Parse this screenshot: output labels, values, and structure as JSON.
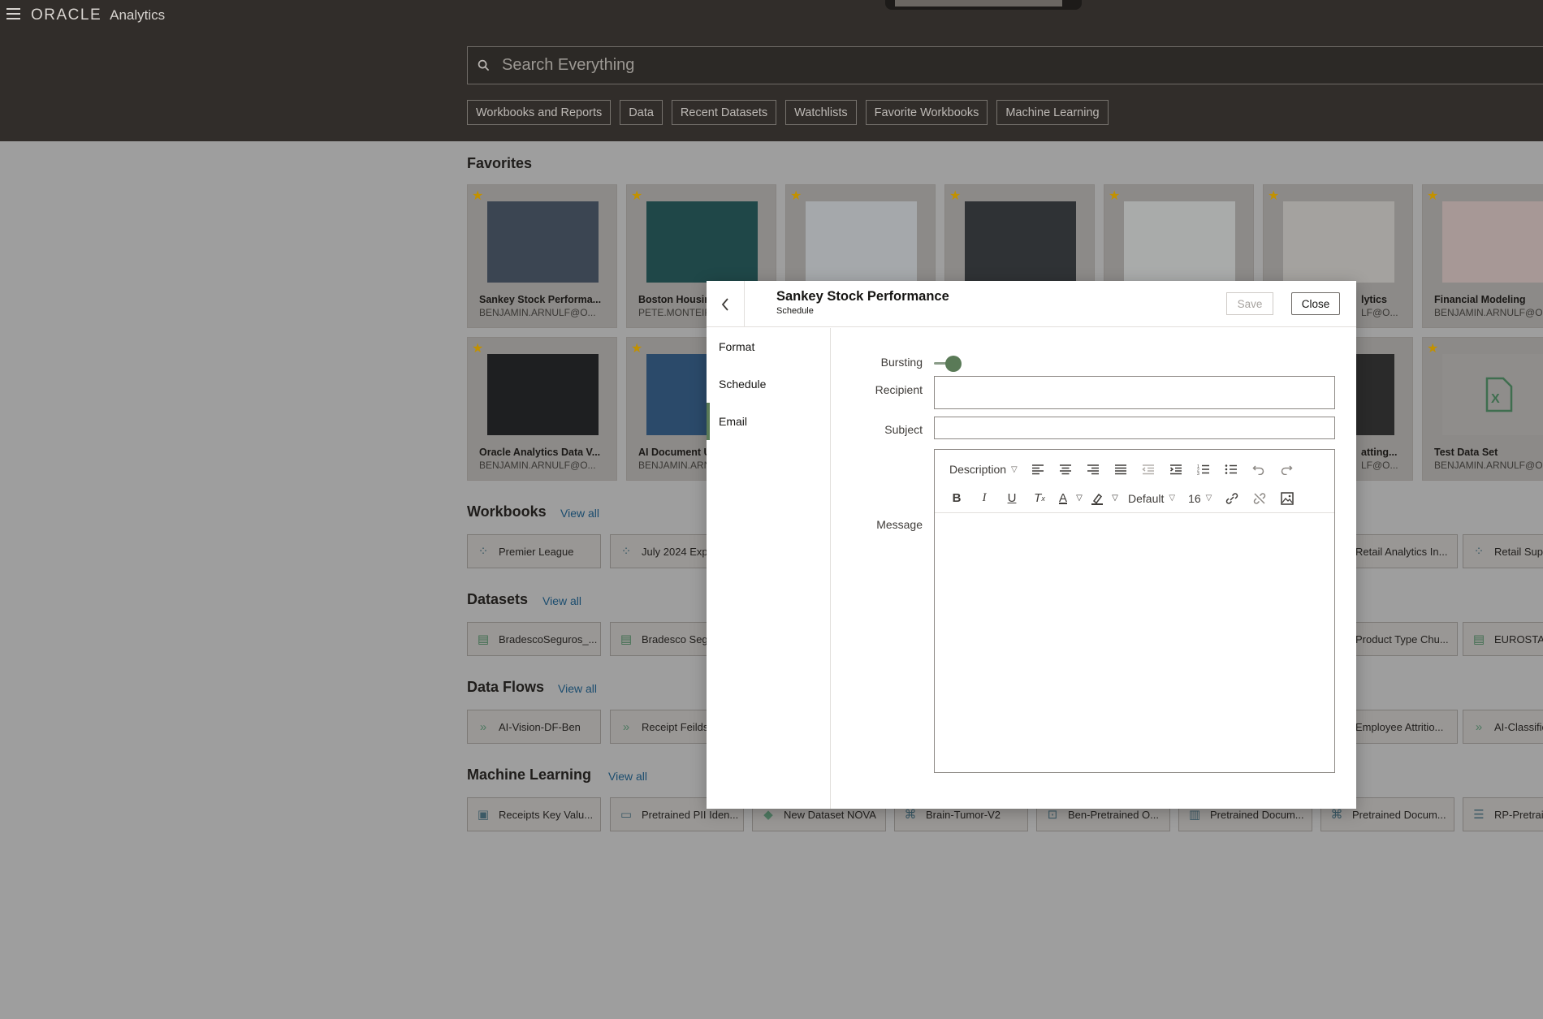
{
  "header": {
    "brand_oracle": "ORACLE",
    "brand_product": "Analytics",
    "search_placeholder": "Search Everything",
    "chips": [
      "Workbooks and Reports",
      "Data",
      "Recent Datasets",
      "Watchlists",
      "Favorite Workbooks",
      "Machine Learning"
    ]
  },
  "favorites": {
    "title": "Favorites",
    "cards": [
      {
        "title": "Sankey Stock Performa...",
        "owner": "BENJAMIN.ARNULF@O..."
      },
      {
        "title": "Boston Housin",
        "owner": "PETE.MONTEIR"
      },
      {
        "title": "",
        "owner": ""
      },
      {
        "title": "",
        "owner": ""
      },
      {
        "title": "",
        "owner": ""
      },
      {
        "title": "lytics",
        "owner": "LF@O..."
      },
      {
        "title": "Financial Modeling",
        "owner": "BENJAMIN.ARNULF@O..."
      },
      {
        "title": "Oracle Analytics Data V...",
        "owner": "BENJAMIN.ARNULF@O..."
      },
      {
        "title": "AI Document U",
        "owner": "BENJAMIN.ARN"
      },
      {
        "title": "",
        "owner": ""
      },
      {
        "title": "",
        "owner": ""
      },
      {
        "title": "",
        "owner": ""
      },
      {
        "title": "atting...",
        "owner": "LF@O..."
      },
      {
        "title": "Test Data Set",
        "owner": "BENJAMIN.ARNULF@O..."
      }
    ]
  },
  "workbooks": {
    "title": "Workbooks",
    "view_all": "View all",
    "items": [
      "Premier League",
      "July 2024 Exp",
      "Retail Analytics In...",
      "Retail Supp"
    ]
  },
  "datasets": {
    "title": "Datasets",
    "view_all": "View all",
    "items": [
      "BradescoSeguros_...",
      "Bradesco Segu",
      "Product Type Chu...",
      "EUROSTAT"
    ]
  },
  "dataflows": {
    "title": "Data Flows",
    "view_all": "View all",
    "items": [
      "AI-Vision-DF-Ben",
      "Receipt Feilds",
      "Employee Attritio...",
      "AI-Classific"
    ]
  },
  "ml": {
    "title": "Machine Learning",
    "view_all": "View all",
    "items": [
      "Receipts Key Valu...",
      "Pretrained PII Iden...",
      "New Dataset NOVA",
      "Brain-Tumor-V2",
      "Ben-Pretrained O...",
      "Pretrained Docum...",
      "Pretrained Docum...",
      "RP-Pretrain"
    ]
  },
  "dialog": {
    "title": "Sankey Stock Performance",
    "subtitle": "Schedule",
    "save_label": "Save",
    "close_label": "Close",
    "nav": [
      "Format",
      "Schedule",
      "Email"
    ],
    "active_nav": "Email",
    "bursting_label": "Bursting",
    "bursting_on": true,
    "recipient_label": "Recipient",
    "recipient_value": "",
    "subject_label": "Subject",
    "subject_value": "",
    "message_label": "Message",
    "toolbar": {
      "paragraph_style": "Description",
      "font": "Default",
      "font_size": "16"
    }
  },
  "colors": {
    "header_bg": "#312d2a",
    "accent_green": "#5a7a57",
    "star": "#c29100"
  }
}
